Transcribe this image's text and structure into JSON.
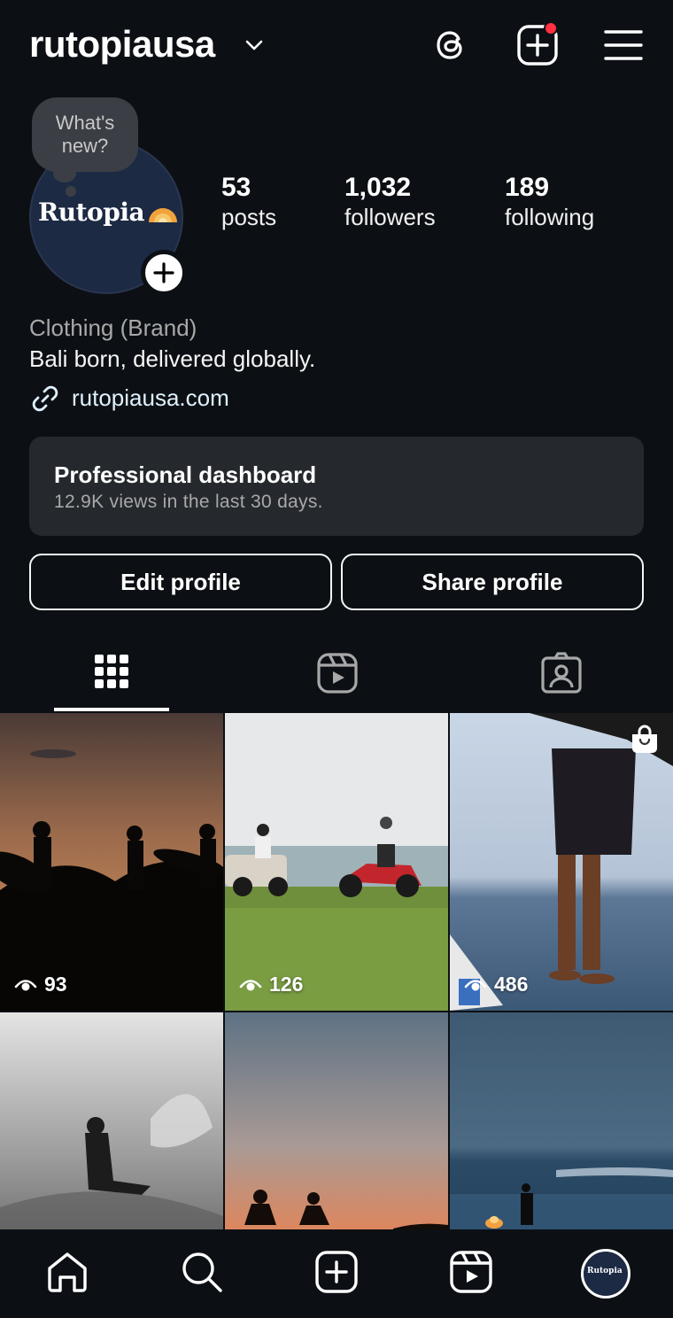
{
  "header": {
    "username": "rutopiausa",
    "icons": [
      "chevron-down-icon",
      "threads-icon",
      "create-post-icon",
      "menu-icon"
    ],
    "notification_dot_color": "#ff3040"
  },
  "profile": {
    "note_bubble": "What's new?",
    "avatar_logo_text": "Rutopia",
    "stats": [
      {
        "value": "53",
        "label": "posts"
      },
      {
        "value": "1,032",
        "label": "followers"
      },
      {
        "value": "189",
        "label": "following"
      }
    ],
    "category": "Clothing (Brand)",
    "bio": "Bali born, delivered globally.",
    "link": "rutopiausa.com"
  },
  "dashboard": {
    "title": "Professional dashboard",
    "subtitle": "12.9K views in the last 30 days."
  },
  "buttons": {
    "edit": "Edit profile",
    "share": "Share profile"
  },
  "tabs": [
    {
      "icon": "grid-icon",
      "active": true
    },
    {
      "icon": "reels-icon",
      "active": false
    },
    {
      "icon": "tagged-icon",
      "active": false
    }
  ],
  "posts": [
    {
      "views": "93",
      "scene": "surfers silhouette at sunset"
    },
    {
      "views": "126",
      "scene": "motorbikes with surfboards by the sea"
    },
    {
      "views": "486",
      "scene": "person standing on boat",
      "shop": true
    },
    {
      "views": "",
      "scene": "surfer in black and white"
    },
    {
      "views": "",
      "scene": "silhouettes at dusk"
    },
    {
      "views": "",
      "scene": "surfer by fire at shoreline"
    }
  ],
  "bottom_nav": [
    "home-icon",
    "search-icon",
    "create-icon",
    "reels-icon",
    "profile-avatar"
  ],
  "colors": {
    "background": "#0c1014",
    "card": "#25292e",
    "link": "#e0f1ff",
    "secondary_text": "#a8a8a8"
  }
}
